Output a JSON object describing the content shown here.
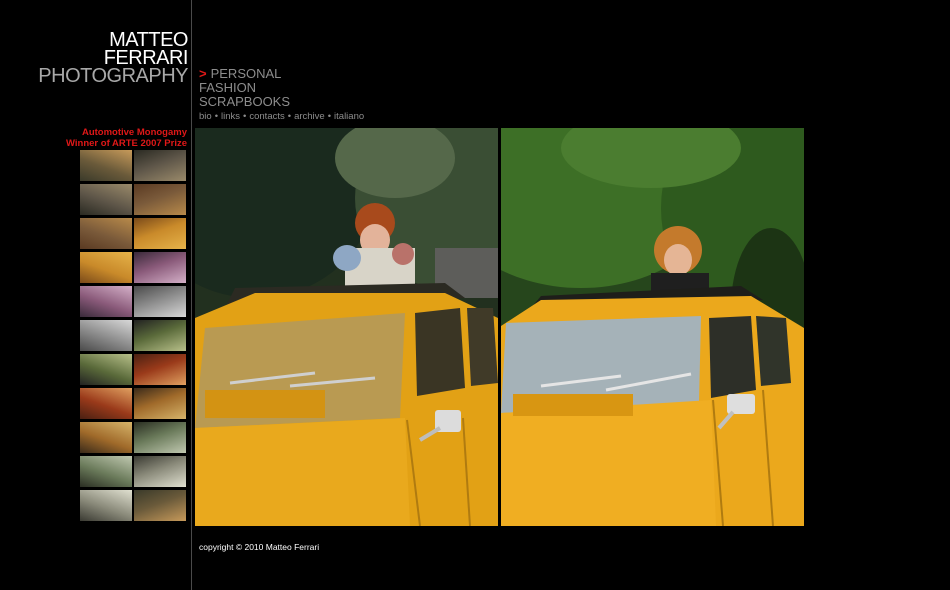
{
  "logo": {
    "line1": "MATTEO",
    "line2": "FERRARI",
    "line3": "PHOTOGRAPHY"
  },
  "nav": {
    "arrow": ">",
    "items": [
      "PERSONAL",
      "FASHION",
      "SCRAPBOOKS"
    ]
  },
  "links": [
    "bio",
    "links",
    "contacts",
    "archive",
    "italiano"
  ],
  "separator": "•",
  "prize": {
    "line1": "Automotive Monogamy",
    "line2": "Winner of ARTE 2007 Prize"
  },
  "thumbnails": {
    "rows": 11,
    "cols": 2
  },
  "copyright": "copyright © 2010 Matteo Ferrari",
  "colors": {
    "accent": "#e01818",
    "nav_text": "#8d8d8d",
    "car_yellow": "#e8a61c"
  }
}
